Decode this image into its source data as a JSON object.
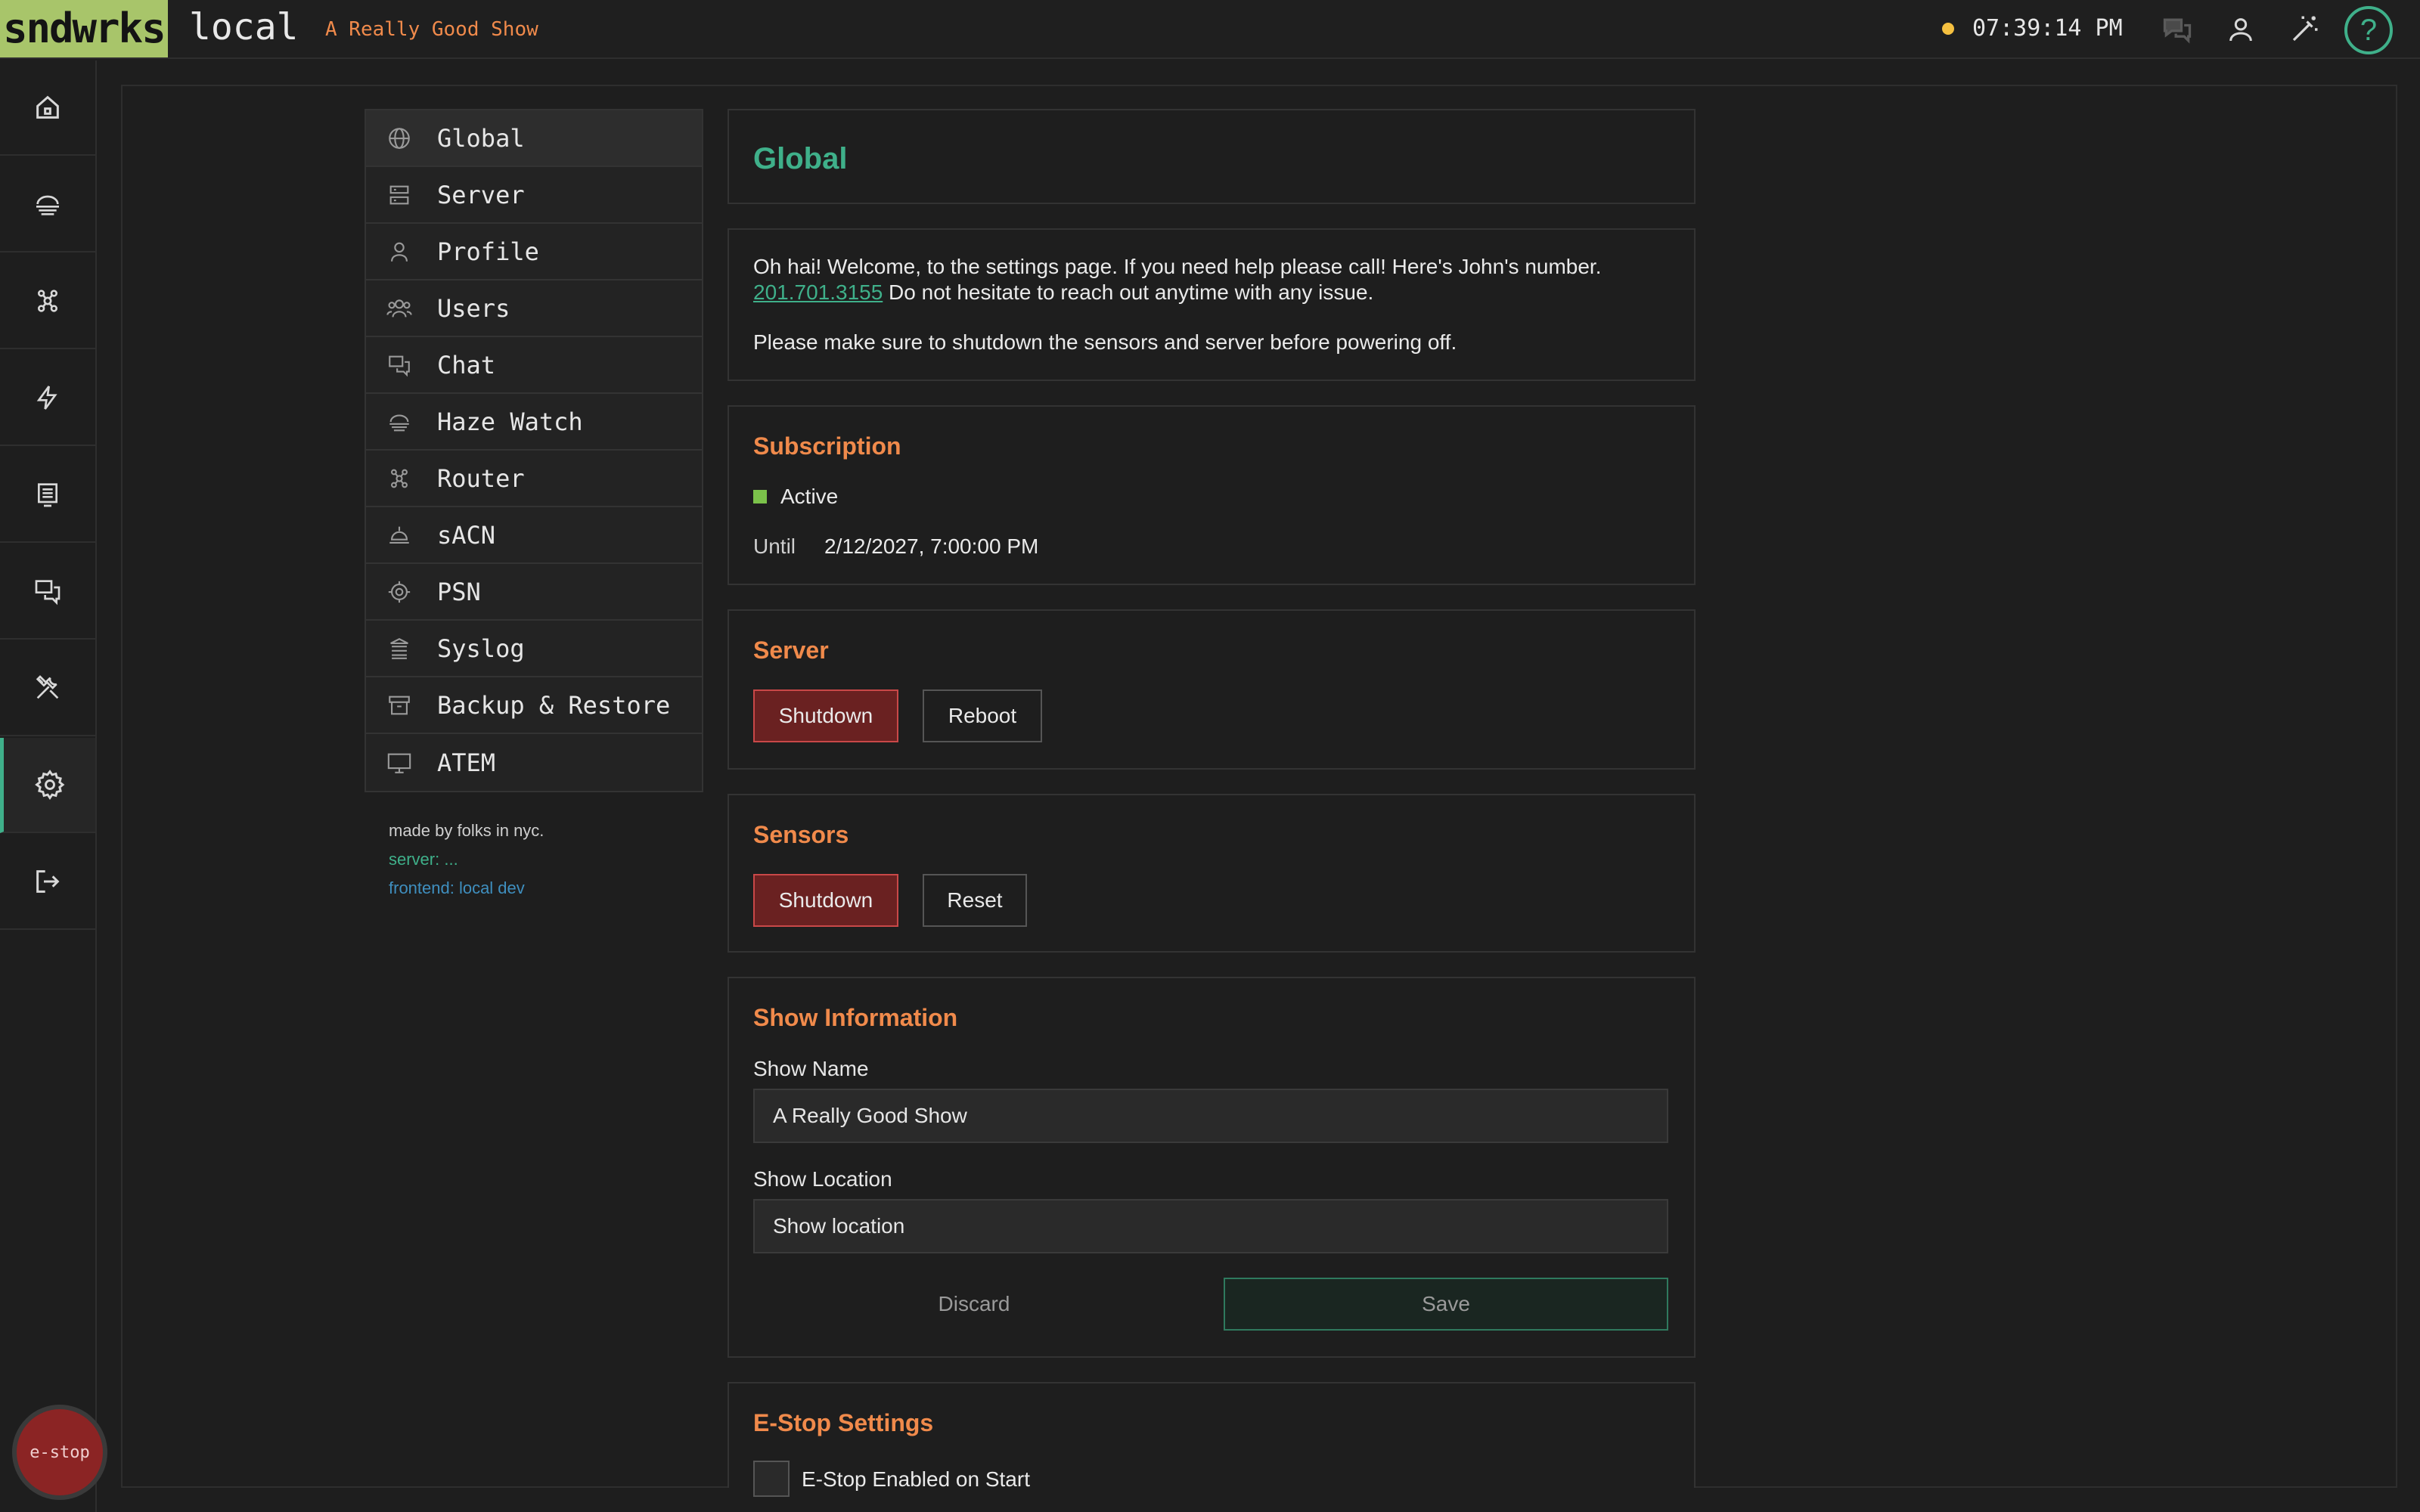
{
  "app": {
    "logo": "sndwrks",
    "environment": "local",
    "show_name": "A Really Good Show",
    "clock": "07:39:14 PM",
    "help": "?",
    "accent": "#3fb08a",
    "warning": "#f08a4b"
  },
  "header_icons": [
    "chat-icon",
    "user-icon",
    "magic-wand-icon",
    "help-icon"
  ],
  "rail": {
    "items": [
      {
        "icon": "home-icon"
      },
      {
        "icon": "haze-icon"
      },
      {
        "icon": "router-icon"
      },
      {
        "icon": "bolt-icon"
      },
      {
        "icon": "monitor-icon"
      },
      {
        "icon": "chat-icon"
      },
      {
        "icon": "tools-icon"
      },
      {
        "icon": "gear-icon",
        "active": true
      },
      {
        "icon": "logout-icon"
      }
    ],
    "estop": "e-stop"
  },
  "settings_nav": {
    "items": [
      {
        "label": "Global",
        "icon": "globe-icon"
      },
      {
        "label": "Server",
        "icon": "server-icon"
      },
      {
        "label": "Profile",
        "icon": "user-icon"
      },
      {
        "label": "Users",
        "icon": "users-icon"
      },
      {
        "label": "Chat",
        "icon": "chat-icon"
      },
      {
        "label": "Haze Watch",
        "icon": "haze-icon"
      },
      {
        "label": "Router",
        "icon": "router-icon"
      },
      {
        "label": "sACN",
        "icon": "lamp-icon"
      },
      {
        "label": "PSN",
        "icon": "target-icon"
      },
      {
        "label": "Syslog",
        "icon": "log-icon"
      },
      {
        "label": "Backup & Restore",
        "icon": "archive-icon"
      },
      {
        "label": "ATEM",
        "icon": "monitor-icon"
      }
    ],
    "credits": {
      "line1": "made by folks in nyc.",
      "line2": "server: ...",
      "line3": "frontend: local dev"
    }
  },
  "global": {
    "title": "Global",
    "welcome_text": "Oh hai! Welcome, to the settings page. If you need help please call! Here's John's number.",
    "phone": "201.701.3155",
    "welcome_tail": " Do not hesitate to reach out anytime with any issue.",
    "shutdown_note": "Please make sure to shutdown the sensors and server before powering off."
  },
  "subscription": {
    "title": "Subscription",
    "status": "Active",
    "until_label": "Until",
    "until_value": "2/12/2027, 7:00:00 PM"
  },
  "server": {
    "title": "Server",
    "shutdown": "Shutdown",
    "reboot": "Reboot"
  },
  "sensors": {
    "title": "Sensors",
    "shutdown": "Shutdown",
    "reset": "Reset"
  },
  "show_info": {
    "title": "Show Information",
    "name_label": "Show Name",
    "name_value": "A Really Good Show",
    "location_label": "Show Location",
    "location_placeholder": "Show location",
    "discard": "Discard",
    "save": "Save"
  },
  "estop_settings": {
    "title": "E-Stop Settings",
    "enabled_label": "E-Stop Enabled on Start"
  }
}
